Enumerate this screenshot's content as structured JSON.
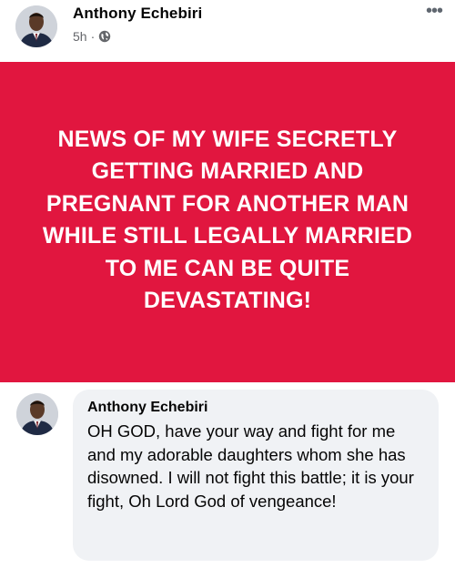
{
  "post": {
    "author": "Anthony Echebiri",
    "time": "5h",
    "separator": "·",
    "privacy_icon": "globe-icon",
    "more_icon": "more-options-icon",
    "more_label": "•••",
    "banner_text": "NEWS OF MY WIFE SECRETLY GETTING MARRIED AND PREGNANT FOR ANOTHER MAN WHILE STILL LEGALLY MARRIED TO ME CAN BE QUITE DEVASTATING!",
    "banner_color": "#e1163f"
  },
  "comment": {
    "author": "Anthony Echebiri",
    "text": "OH GOD, have your way and fight for me and my adorable daughters whom she has disowned. I will not fight this battle; it is your fight, Oh Lord God of vengeance!",
    "bubble_color": "#f0f2f5"
  }
}
